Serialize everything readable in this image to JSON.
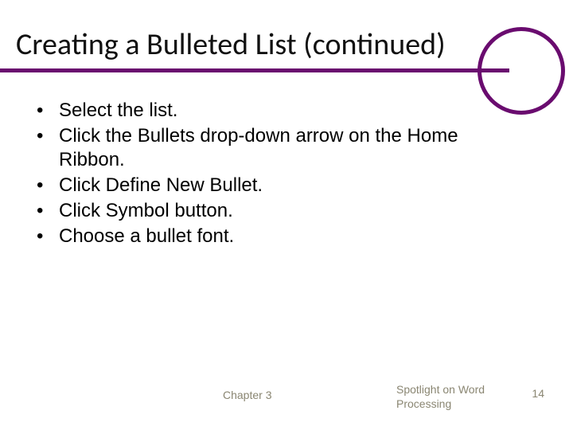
{
  "title": "Creating a Bulleted List (continued)",
  "bullets": [
    "Select the list.",
    "Click the Bullets drop-down arrow on the Home Ribbon.",
    "Click Define New Bullet.",
    "Click Symbol button.",
    "Choose a bullet font."
  ],
  "footer": {
    "center": "Chapter 3",
    "right": "Spotlight on Word Processing",
    "page": "14"
  },
  "colors": {
    "accent": "#6a0c6f",
    "footerText": "#8a8672"
  }
}
